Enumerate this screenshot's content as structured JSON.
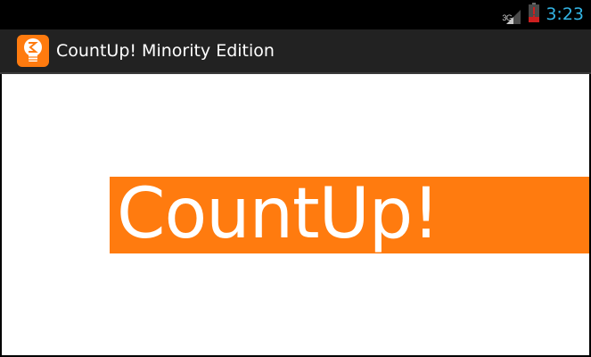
{
  "status_bar": {
    "network_type": "3G",
    "signal_icon": "cell-signal-icon",
    "battery_icon": "battery-low-icon",
    "time": "3:23",
    "time_color": "#33b5e5"
  },
  "action_bar": {
    "app_icon": "lightbulb-icon",
    "title": "CountUp! Minority Edition",
    "background": "#222222"
  },
  "splash": {
    "logo_text": "CountUp!",
    "accent_color": "#ff7b0f"
  }
}
